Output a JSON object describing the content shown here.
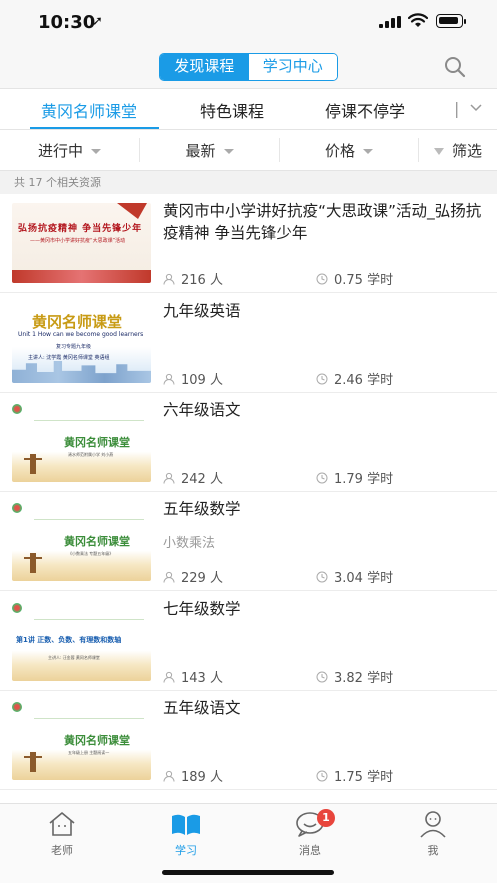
{
  "status_bar": {
    "time": "10:30"
  },
  "header": {
    "segments": [
      {
        "label": "发现课程",
        "active": true
      },
      {
        "label": "学习中心",
        "active": false
      }
    ]
  },
  "category_tabs": [
    {
      "label": "黄冈名师课堂",
      "active": true
    },
    {
      "label": "特色课程",
      "active": false
    },
    {
      "label": "停课不停学",
      "active": false
    }
  ],
  "filters": [
    {
      "label": "进行中"
    },
    {
      "label": "最新"
    },
    {
      "label": "价格"
    },
    {
      "label": "筛选"
    }
  ],
  "result_count": "共 17 个相关资源",
  "courses": [
    {
      "title": "黄冈市中小学讲好抗疫“大思政课”活动_弘扬抗疫精神 争当先锋少年",
      "subtitle": "",
      "learners": "216 人",
      "hours": "0.75 学时",
      "thumb": {
        "style": "red",
        "line1": "弘扬抗疫精神  争当先锋少年",
        "line2": "——黄冈市中小学讲好抗疫“大思政课”活动"
      }
    },
    {
      "title": "九年级英语",
      "subtitle": "",
      "learners": "109 人",
      "hours": "2.46 学时",
      "thumb": {
        "style": "blue",
        "line1": "黄冈名师课堂",
        "line2": "Unit 1  How can we  become good learners",
        "line3": "复习专题九年级",
        "line4": "主讲人: 沈学霞   黄冈名师课堂 英语组"
      }
    },
    {
      "title": "六年级语文",
      "subtitle": "",
      "learners": "242 人",
      "hours": "1.79 学时",
      "thumb": {
        "style": "field",
        "line1": "黄冈名师课堂",
        "line2": "浠水师范附属小学    刘小燕"
      }
    },
    {
      "title": "五年级数学",
      "subtitle": "小数乘法",
      "learners": "229 人",
      "hours": "3.04 学时",
      "thumb": {
        "style": "field",
        "line1": "黄冈名师课堂",
        "line2": "《小数乘法    专题五年级》"
      }
    },
    {
      "title": "七年级数学",
      "subtitle": "",
      "learners": "143 人",
      "hours": "3.82 学时",
      "thumb": {
        "style": "field-alt",
        "line1": "第1讲   正数、负数、有理数和数轴",
        "line2": "主讲人: 汪金蓉    黄冈名师课堂"
      }
    },
    {
      "title": "五年级语文",
      "subtitle": "",
      "learners": "189 人",
      "hours": "1.75 学时",
      "thumb": {
        "style": "field",
        "line1": "黄冈名师课堂",
        "line2": "五年级上册    主题阅读一"
      }
    }
  ],
  "tab_bar": [
    {
      "label": "老师",
      "active": false,
      "icon": "house-icon"
    },
    {
      "label": "学习",
      "active": true,
      "icon": "book-icon"
    },
    {
      "label": "消息",
      "active": false,
      "icon": "chat-icon",
      "badge": "1"
    },
    {
      "label": "我",
      "active": false,
      "icon": "person-icon"
    }
  ],
  "colors": {
    "accent": "#1a9be6",
    "badge": "#e8453c"
  }
}
